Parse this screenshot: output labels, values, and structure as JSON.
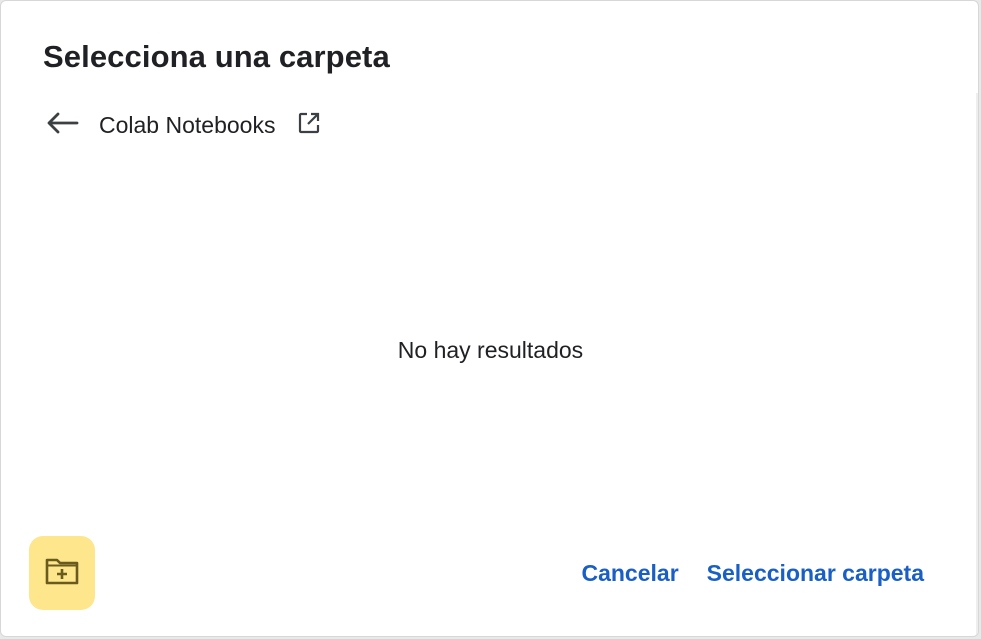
{
  "dialog": {
    "title": "Selecciona una carpeta",
    "breadcrumb": {
      "current_folder": "Colab Notebooks",
      "back_icon": "arrow-left-icon",
      "open_icon": "open-in-new-icon"
    },
    "empty_message": "No hay resultados",
    "new_folder_icon": "create-new-folder-icon",
    "buttons": {
      "cancel": "Cancelar",
      "select": "Seleccionar carpeta"
    },
    "colors": {
      "accent": "#1a5fc5",
      "new_folder_bg": "#fde68c",
      "text": "#202124"
    }
  }
}
